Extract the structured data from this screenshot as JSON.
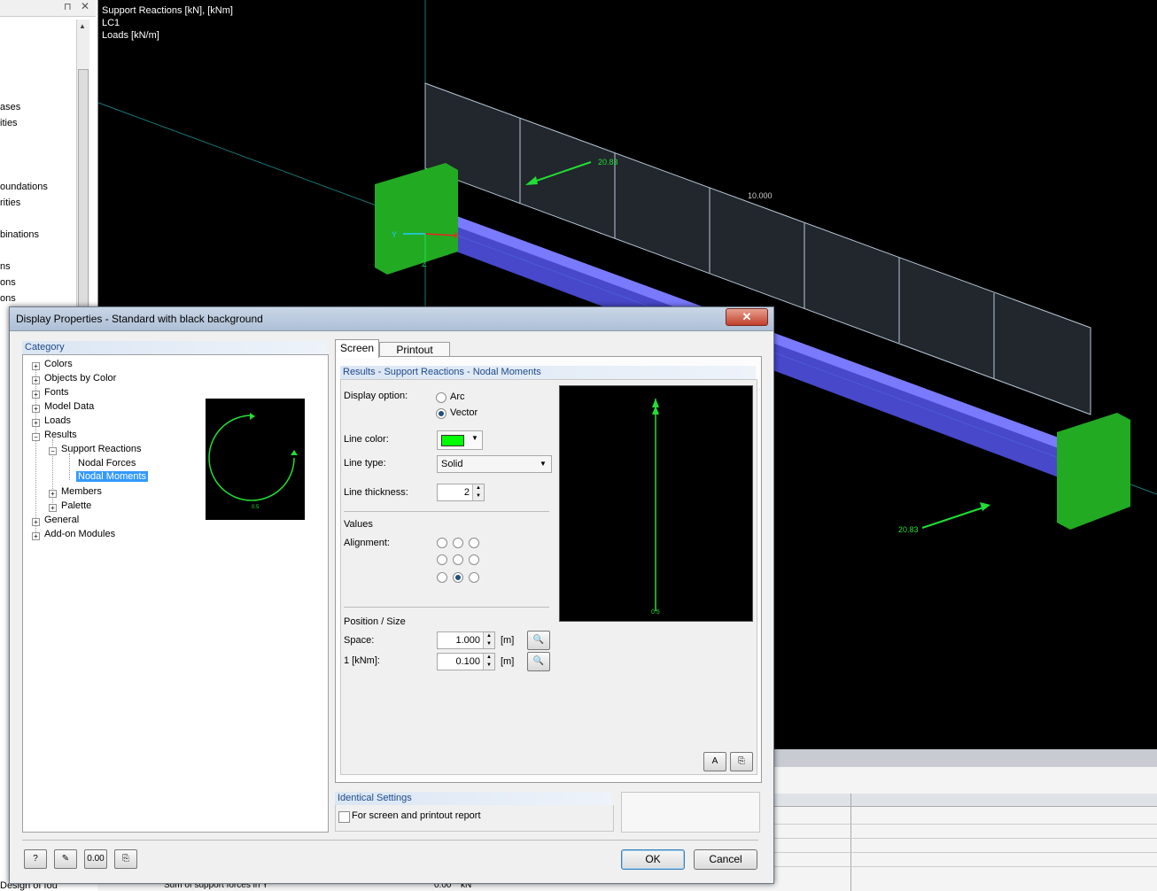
{
  "navigator": {
    "items": [
      "ases",
      "ities",
      "oundations",
      "rities",
      "binations",
      "ns",
      "ons",
      "ons"
    ],
    "bottom_item": "Design of fou"
  },
  "view": {
    "info_lines": [
      "Support Reactions [kN], [kNm]",
      "LC1",
      "Loads [kN/m]"
    ],
    "load_value": "10.000",
    "moment_value_1": "20.83",
    "moment_value_2": "20.83",
    "axis_y": "Y",
    "axis_x": "X",
    "axis_z": "Z"
  },
  "table": {
    "row_text": "Sum of support forces in Y",
    "row_value": "0.00",
    "row_unit": "kN"
  },
  "dialog": {
    "title": "Display Properties - Standard with black background",
    "close": "✕",
    "category_header": "Category",
    "tree": {
      "colors": "Colors",
      "objects_by_color": "Objects by Color",
      "fonts": "Fonts",
      "model_data": "Model Data",
      "loads": "Loads",
      "results": "Results",
      "support_reactions": "Support Reactions",
      "nodal_forces": "Nodal Forces",
      "nodal_moments": "Nodal Moments",
      "members": "Members",
      "palette": "Palette",
      "general": "General",
      "addon_modules": "Add-on Modules"
    },
    "preview_small_label": "0.5",
    "tabs": [
      "Screen",
      "Printout Report"
    ],
    "section_header": "Results - Support Reactions - Nodal Moments",
    "display_option_label": "Display option:",
    "display_options": [
      "Arc",
      "Vector"
    ],
    "selected_display_option": "Vector",
    "line_color_label": "Line color:",
    "line_color": "#00ff00",
    "line_type_label": "Line type:",
    "line_type": "Solid",
    "line_thickness_label": "Line thickness:",
    "line_thickness": "2",
    "values_label": "Values",
    "alignment_label": "Alignment:",
    "alignment_selected": "bottom-center",
    "position_size_label": "Position / Size",
    "space_label": "Space:",
    "space_value": "1.000",
    "space_unit": "[m]",
    "scale_label": "1  [kNm]:",
    "scale_value": "0.100",
    "scale_unit": "[m]",
    "preview_large_label": "0.5",
    "identical_settings_header": "Identical Settings",
    "identical_checkbox_label": "For screen and printout report",
    "ok": "OK",
    "cancel": "Cancel"
  },
  "colors": {
    "accent_green": "#22dd33",
    "member_blue": "#5555ee",
    "support_green": "#22aa22",
    "dialog_header_text": "#1f4a8a"
  }
}
